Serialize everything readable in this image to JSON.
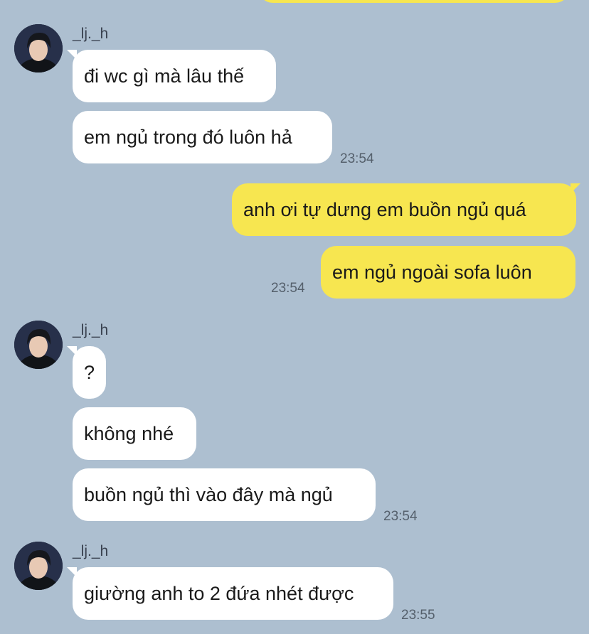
{
  "sender_name": "_lj._h",
  "groups": [
    {
      "direction": "in",
      "sender": "_lj._h",
      "messages": [
        "đi wc gì mà lâu thế",
        "em ngủ trong đó luôn hả"
      ],
      "time": "23:54"
    },
    {
      "direction": "out",
      "messages": [
        "anh ơi tự dưng em buồn ngủ quá",
        "em ngủ ngoài sofa luôn"
      ],
      "time": "23:54"
    },
    {
      "direction": "in",
      "sender": "_lj._h",
      "messages": [
        "?",
        "không nhé",
        "buồn ngủ thì vào đây mà ngủ"
      ],
      "time": "23:54"
    },
    {
      "direction": "in",
      "sender": "_lj._h",
      "messages": [
        "giường anh to 2 đứa nhét được"
      ],
      "time": "23:55"
    }
  ],
  "colors": {
    "background": "#adbfd0",
    "incoming_bubble": "#ffffff",
    "outgoing_bubble": "#f7e650",
    "timestamp": "#55606c"
  },
  "icons": {
    "avatar": "profile-photo"
  }
}
